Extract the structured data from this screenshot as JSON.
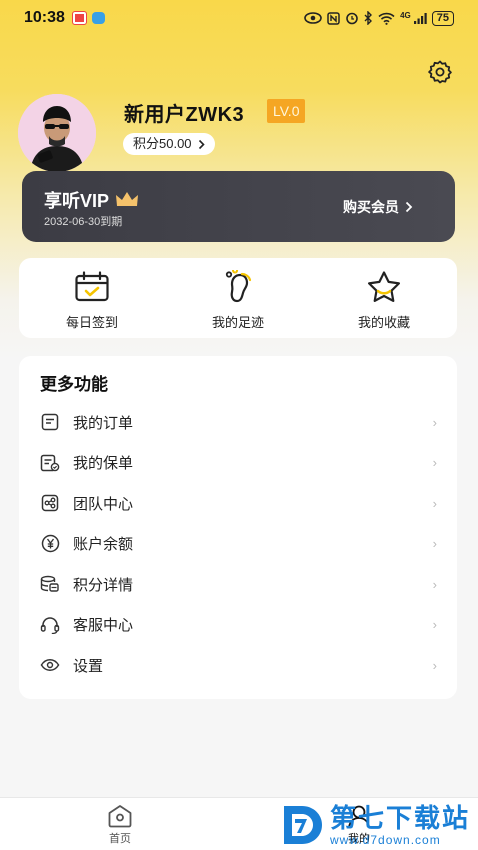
{
  "status_bar": {
    "time": "10:38",
    "network": "4G",
    "battery": "75"
  },
  "profile": {
    "username": "新用户ZWK3",
    "level": "LV.0",
    "points_label": "积分50.00"
  },
  "vip": {
    "title": "享听VIP",
    "expire": "2032-06-30到期",
    "buy_label": "购买会员"
  },
  "quick_actions": [
    {
      "label": "每日签到",
      "icon": "calendar-check-icon"
    },
    {
      "label": "我的足迹",
      "icon": "footprint-icon"
    },
    {
      "label": "我的收藏",
      "icon": "star-icon"
    }
  ],
  "more": {
    "title": "更多功能",
    "items": [
      {
        "label": "我的订单",
        "icon": "order-icon"
      },
      {
        "label": "我的保单",
        "icon": "policy-icon"
      },
      {
        "label": "团队中心",
        "icon": "team-icon"
      },
      {
        "label": "账户余额",
        "icon": "yuan-icon"
      },
      {
        "label": "积分详情",
        "icon": "coins-icon"
      },
      {
        "label": "客服中心",
        "icon": "headset-icon"
      },
      {
        "label": "设置",
        "icon": "eye-icon"
      }
    ]
  },
  "bottom_nav": {
    "home_label": "首页",
    "mine_label": "我的"
  },
  "watermark": {
    "title": "第七下载站",
    "url": "www.d7down.com"
  },
  "colors": {
    "brand_yellow": "#f9d84a",
    "level_orange": "#f5a623",
    "vip_dark": "#3c3c44",
    "watermark_blue": "#1a7fd6"
  }
}
